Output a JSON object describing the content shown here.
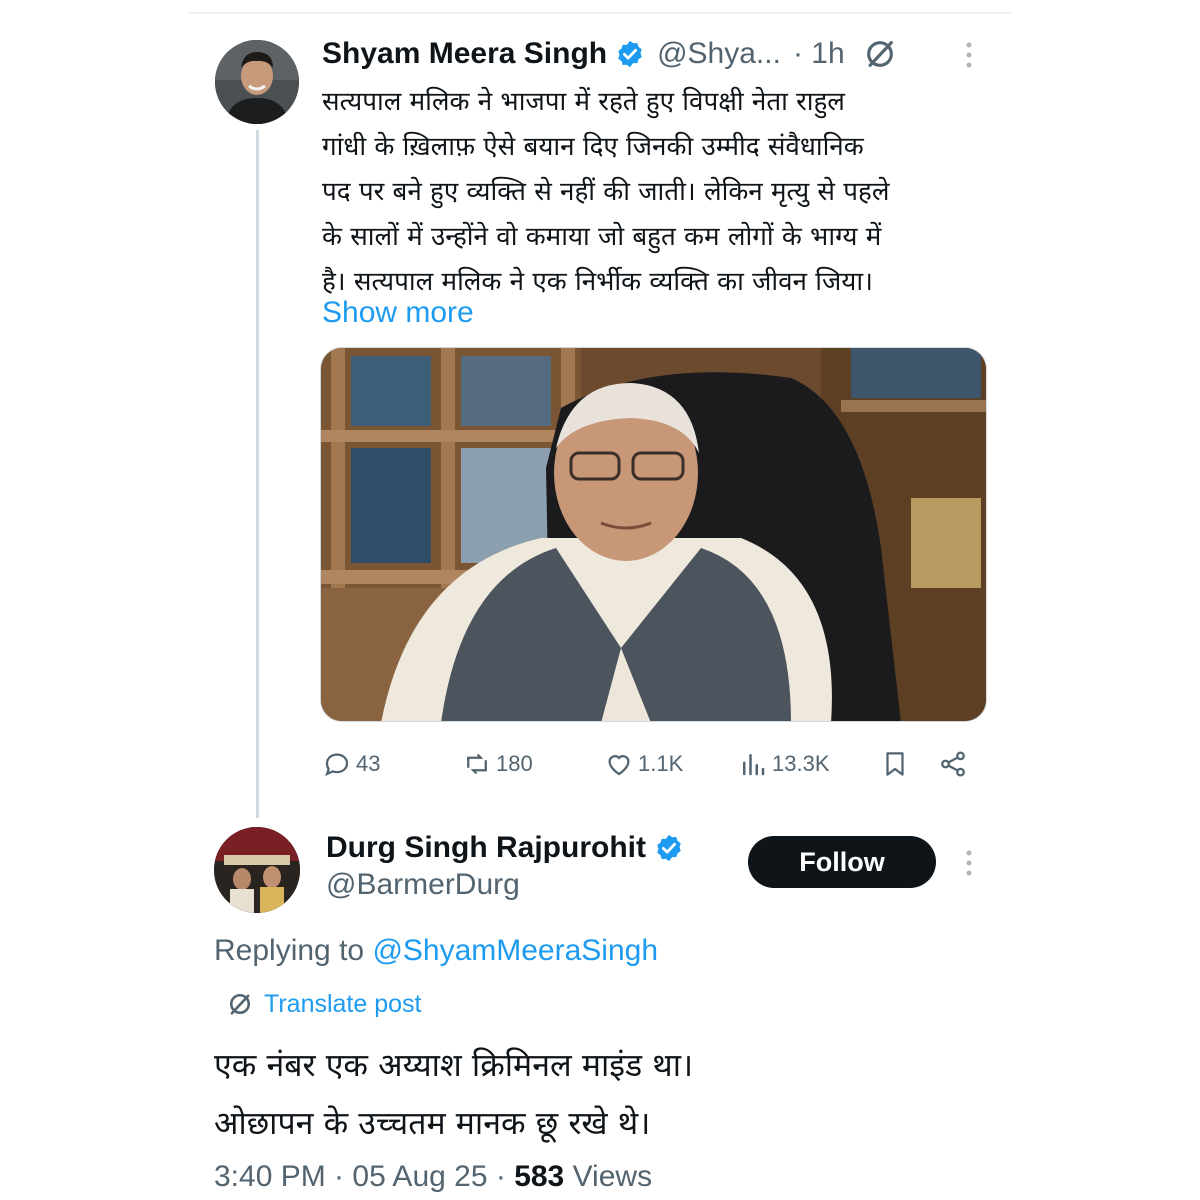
{
  "parent_tweet": {
    "author_name": "Shyam Meera Singh",
    "handle": "@Shya...",
    "time": "· 1h",
    "text_lines": [
      "सत्यपाल मलिक ने भाजपा में रहते हुए विपक्षी नेता राहुल",
      "गांधी के ख़िलाफ़ ऐसे बयान दिए जिनकी उम्मीद संवैधानिक",
      "पद पर बने हुए व्यक्ति से नहीं की जाती। लेकिन मृत्यु से पहले",
      "के सालों में उन्होंने वो कमाया जो बहुत कम लोगों के भाग्य में",
      "है। सत्यपाल मलिक ने एक निर्भीक व्यक्ति का जीवन जिया।"
    ],
    "show_more": "Show more",
    "stats": {
      "replies": "43",
      "reposts": "180",
      "likes": "1.1K",
      "views": "13.3K"
    }
  },
  "reply_tweet": {
    "author_name": "Durg Singh Rajpurohit",
    "handle": "@BarmerDurg",
    "follow_label": "Follow",
    "replying_prefix": "Replying to",
    "replying_to": "@ShyamMeeraSingh",
    "translate_label": "Translate post",
    "text_lines": [
      "एक नंबर एक अय्याश क्रिमिनल माइंड था।",
      "ओछापन के उच्चतम मानक छू रखे थे।"
    ],
    "timestamp": "3:40 PM · 05 Aug 25 · ",
    "views_count": "583",
    "views_label": " Views"
  },
  "colors": {
    "accent": "#1d9bf0",
    "text": "#0f1419",
    "secondary": "#536471",
    "follow_bg": "#0f1419"
  }
}
